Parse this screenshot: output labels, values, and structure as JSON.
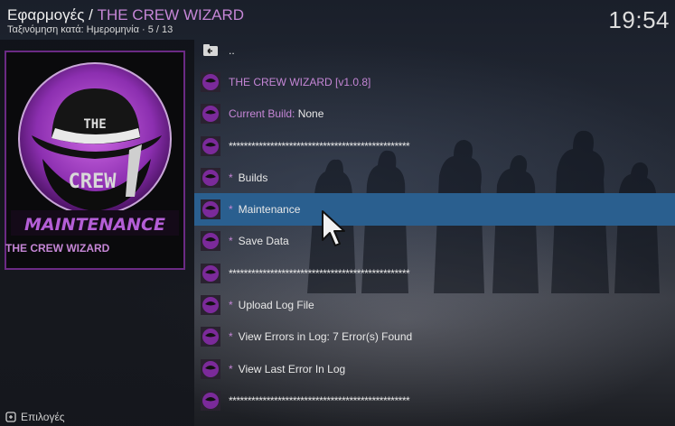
{
  "header": {
    "breadcrumb_root": "Εφαρμογές",
    "breadcrumb_sep": " / ",
    "breadcrumb_current": "THE CREW WIZARD",
    "sort_info": "Ταξινόμηση κατά: Ημερομηνία  ·  5 / 13",
    "clock": "19:54"
  },
  "left_panel": {
    "thumbnail_text_top": "THE",
    "thumbnail_text_bottom": "CREW",
    "thumbnail_banner": "MAINTENANCE",
    "selected_title": "THE CREW WIZARD",
    "options_label": "Επιλογές"
  },
  "list": {
    "back": "..",
    "addon_name": "THE CREW WIZARD",
    "addon_version": "[v1.0.8]",
    "current_build_label": "Current Build:",
    "current_build_value": "None",
    "separator": "************************************************",
    "bullet": "*",
    "builds": "Builds",
    "maintenance": "Maintenance",
    "save_data": "Save Data",
    "upload_log": "Upload Log File",
    "view_errors": "View Errors in Log: 7 Error(s) Found",
    "view_last_error": "View Last Error In Log"
  },
  "colors": {
    "accent_purple": "#c586d6",
    "selection_blue": "#2a5f8f",
    "thumbnail_border": "#6b2a84"
  }
}
